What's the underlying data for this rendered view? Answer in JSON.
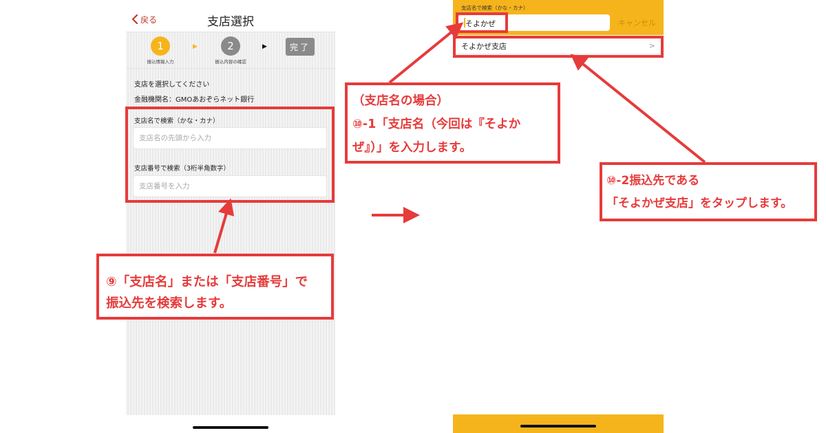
{
  "left_screen": {
    "back_label": "戻る",
    "title": "支店選択",
    "steps": [
      {
        "number": "1",
        "label": "振込情報入力"
      },
      {
        "number": "2",
        "label": "振込内容の確認"
      }
    ],
    "step_done_label": "完了",
    "step_arrow_glyph": "▶",
    "prompt": "支店を選択してください",
    "bank_name": "金融機関名：GMOあおぞらネット銀行",
    "search_by_name_label": "支店名で検索（かな・カナ）",
    "search_by_name_placeholder": "支店名の先頭から入力",
    "search_by_number_label": "支店番号で検索（3桁半角数字）",
    "search_by_number_placeholder": "支店番号を入力"
  },
  "right_screen": {
    "search_label": "支店名で検索（かな・カナ）",
    "search_value": "そよかぜ",
    "cancel_label": "キャンセル",
    "result_item": "そよかぜ支店",
    "result_chevron": ">"
  },
  "annotations": {
    "step9_line1": "⑨「支店名」または「支店番号」で",
    "step9_line2": "振込先を検索します。",
    "step10_1_line1": "（支店名の場合）",
    "step10_1_line2": "⑩-1「支店名（今回は『そよか",
    "step10_1_line3": "ぜ』）」を入力します。",
    "step10_2_line1": "⑩-2振込先である",
    "step10_2_line2": "「そよかぜ支店」をタップします。"
  },
  "colors": {
    "accent_red": "#e63b3b",
    "step_active": "#f6b41c",
    "step_inactive": "#8a8a8a",
    "header_yellow": "#f6b41c",
    "back_red": "#c0392b"
  },
  "icons": {
    "back": "chevron-left-icon",
    "result": "chevron-right-icon"
  }
}
